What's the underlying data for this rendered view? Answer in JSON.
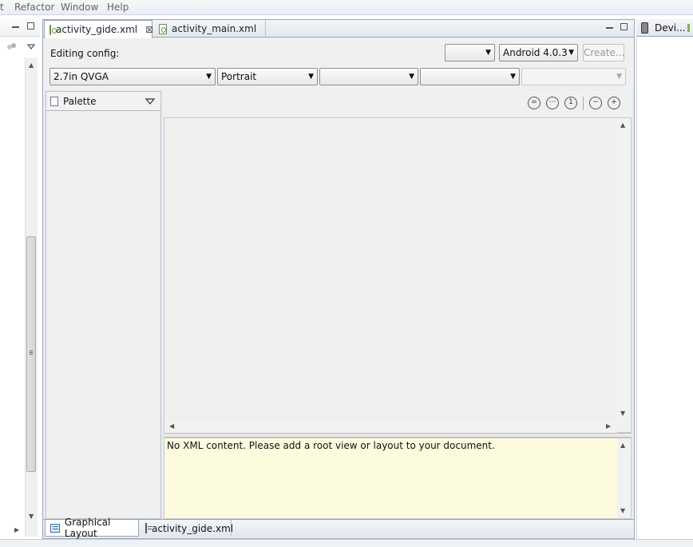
{
  "menubar": {
    "items": [
      "t",
      "Refactor",
      "Window",
      "Help"
    ]
  },
  "editor": {
    "tabs": [
      {
        "label": "activity_gide.xml",
        "active": true
      },
      {
        "label": "activity_main.xml",
        "active": false
      }
    ]
  },
  "config": {
    "editing_label": "Editing config:",
    "empty_combo": "",
    "api_level": "Android 4.0.3",
    "create_button": "Create...",
    "device": "2.7in QVGA",
    "orientation": "Portrait",
    "theme": "",
    "activity": "",
    "extra": ""
  },
  "palette": {
    "title": "Palette"
  },
  "error": {
    "message": "No XML content. Please add a root view or layout to your document."
  },
  "bottom_tabs": [
    {
      "label": "Graphical Layout",
      "active": true
    },
    {
      "label": "activity_gide.xml",
      "active": false
    }
  ],
  "right_panel": {
    "title": "Devi..."
  },
  "icons": {
    "zoom": [
      "zoom-fit-icon",
      "zoom-real-size-icon",
      "zoom-100-icon",
      "zoom-out-icon",
      "zoom-in-icon"
    ]
  }
}
